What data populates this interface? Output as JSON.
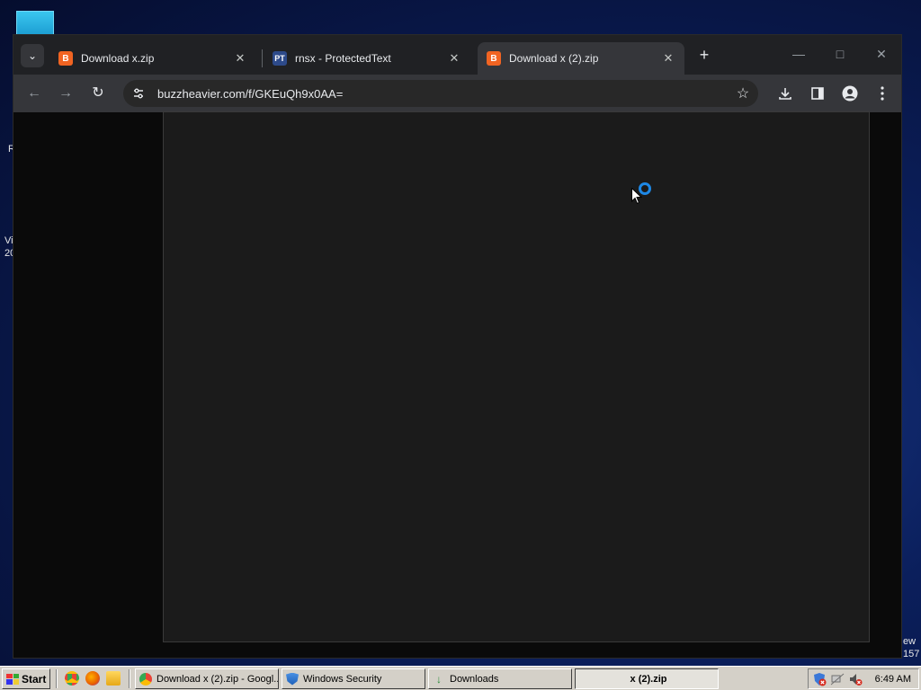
{
  "desktop": {
    "left_fragments": [
      "R",
      "Vi",
      "20"
    ],
    "right_fragments": [
      "ew",
      "157"
    ]
  },
  "browser": {
    "tabs": [
      {
        "label": "Download x.zip",
        "favicon": "B",
        "active": false
      },
      {
        "label": "rnsx - ProtectedText",
        "favicon": "PT",
        "active": false
      },
      {
        "label": "Download x (2).zip",
        "favicon": "B",
        "active": true
      }
    ],
    "close_glyph": "✕",
    "new_tab_glyph": "+",
    "url": "buzzheavier.com/f/GKEuQh9x0AA=",
    "colors": {
      "accent_spinner": "#1e88e5",
      "favicon_b": "#f16422",
      "favicon_pt": "#2d4a8a"
    }
  },
  "taskbar": {
    "start_label": "Start",
    "buttons": [
      {
        "label": "Download x (2).zip - Googl...",
        "icon": "chrome-icon"
      },
      {
        "label": "Windows Security",
        "icon": "shield-icon"
      },
      {
        "label": "Downloads",
        "icon": "download-arrow-icon"
      },
      {
        "label": "x (2).zip",
        "icon": "",
        "pressed": true
      }
    ],
    "clock": "6:49 AM"
  }
}
